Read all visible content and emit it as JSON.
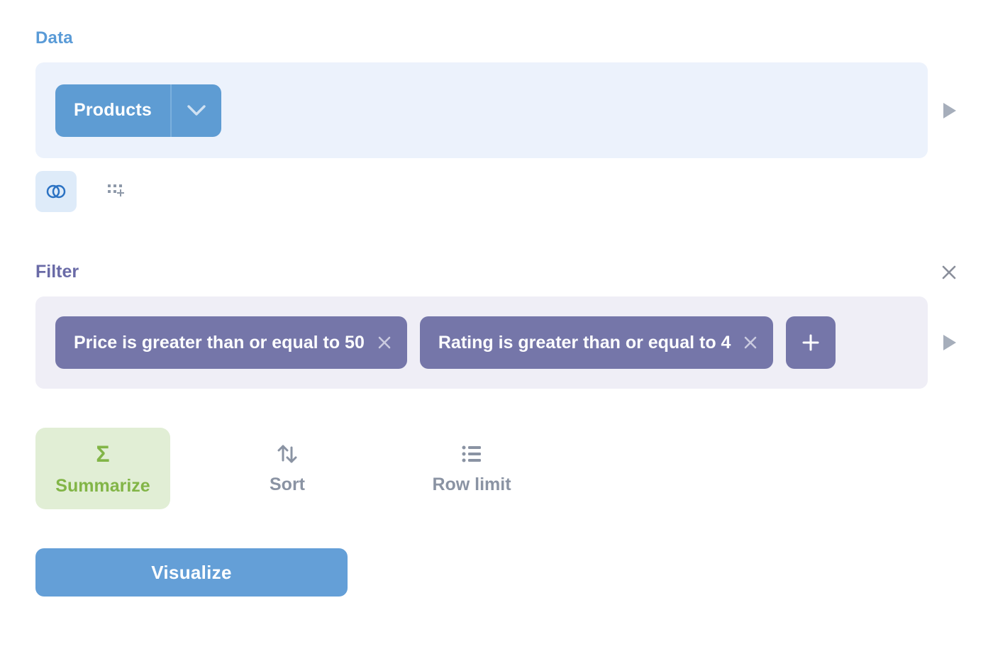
{
  "sections": {
    "data": {
      "label": "Data"
    },
    "filter": {
      "label": "Filter"
    }
  },
  "data": {
    "selected_table": "Products"
  },
  "filter": {
    "chips": [
      {
        "label": "Price is greater than or equal to 50"
      },
      {
        "label": "Rating is greater than or equal to 4"
      }
    ]
  },
  "actions": {
    "summarize": "Summarize",
    "sort": "Sort",
    "row_limit": "Row limit"
  },
  "visualize_label": "Visualize"
}
